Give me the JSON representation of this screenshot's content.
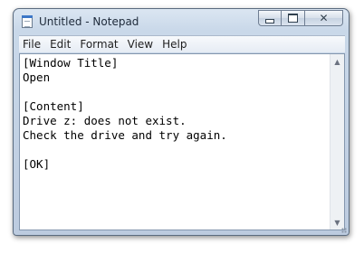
{
  "window": {
    "title": "Untitled - Notepad",
    "icon": "notepad-icon"
  },
  "caption_buttons": {
    "minimize_icon": "minimize-icon",
    "maximize_icon": "maximize-icon",
    "close_icon": "close-icon",
    "close_glyph": "✕"
  },
  "menu": {
    "items": [
      {
        "label": "File"
      },
      {
        "label": "Edit"
      },
      {
        "label": "Format"
      },
      {
        "label": "View"
      },
      {
        "label": "Help"
      }
    ]
  },
  "editor": {
    "content": "[Window Title]\nOpen\n\n[Content]\nDrive z: does not exist.\nCheck the drive and try again.\n\n[OK]"
  },
  "scrollbar": {
    "up_arrow": "▲",
    "down_arrow": "▼"
  }
}
